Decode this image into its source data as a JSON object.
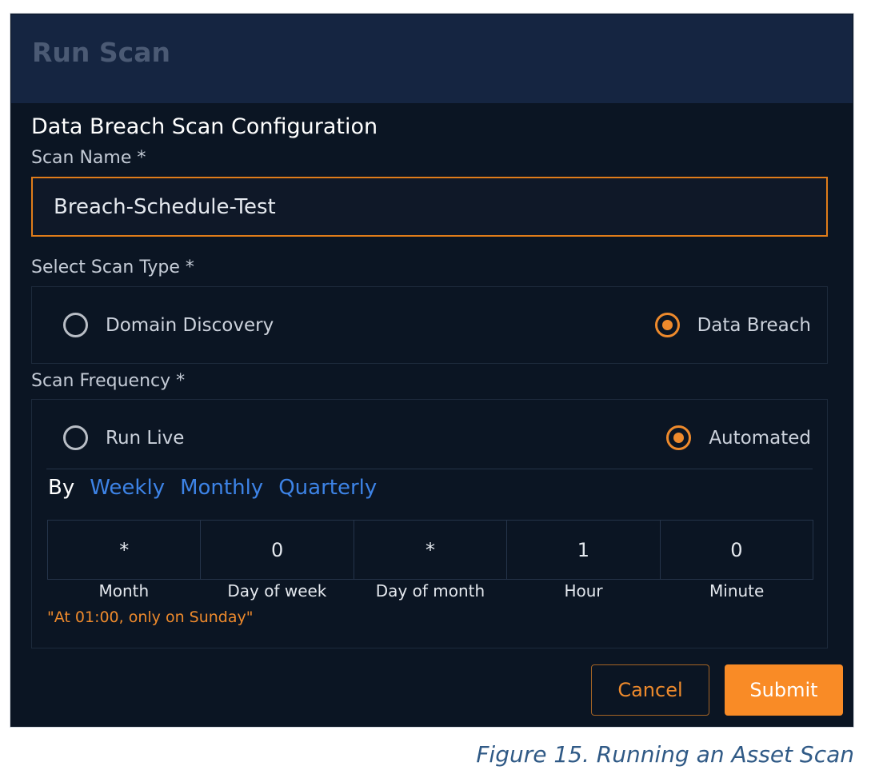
{
  "dialog": {
    "title": "Run Scan",
    "section_title": "Data Breach Scan Configuration"
  },
  "scan_name": {
    "label": "Scan Name *",
    "value": "Breach-Schedule-Test"
  },
  "scan_type": {
    "label": "Select Scan Type *",
    "options": [
      {
        "label": "Domain Discovery",
        "selected": false
      },
      {
        "label": "Data Breach",
        "selected": true
      }
    ]
  },
  "scan_frequency": {
    "label": "Scan Frequency *",
    "options": [
      {
        "label": "Run Live",
        "selected": false
      },
      {
        "label": "Automated",
        "selected": true
      }
    ],
    "by_label": "By",
    "presets": [
      "Weekly",
      "Monthly",
      "Quarterly"
    ],
    "cron": [
      {
        "label": "Month",
        "value": "*"
      },
      {
        "label": "Day of week",
        "value": "0"
      },
      {
        "label": "Day of month",
        "value": "*"
      },
      {
        "label": "Hour",
        "value": "1"
      },
      {
        "label": "Minute",
        "value": "0"
      }
    ],
    "description": "\"At 01:00, only on Sunday\""
  },
  "buttons": {
    "cancel": "Cancel",
    "submit": "Submit"
  },
  "caption": "Figure 15. Running an Asset Scan",
  "colors": {
    "accent_orange": "#f98b26",
    "link_blue": "#3d83e6",
    "background": "#0b1523",
    "header_background": "#152541"
  }
}
